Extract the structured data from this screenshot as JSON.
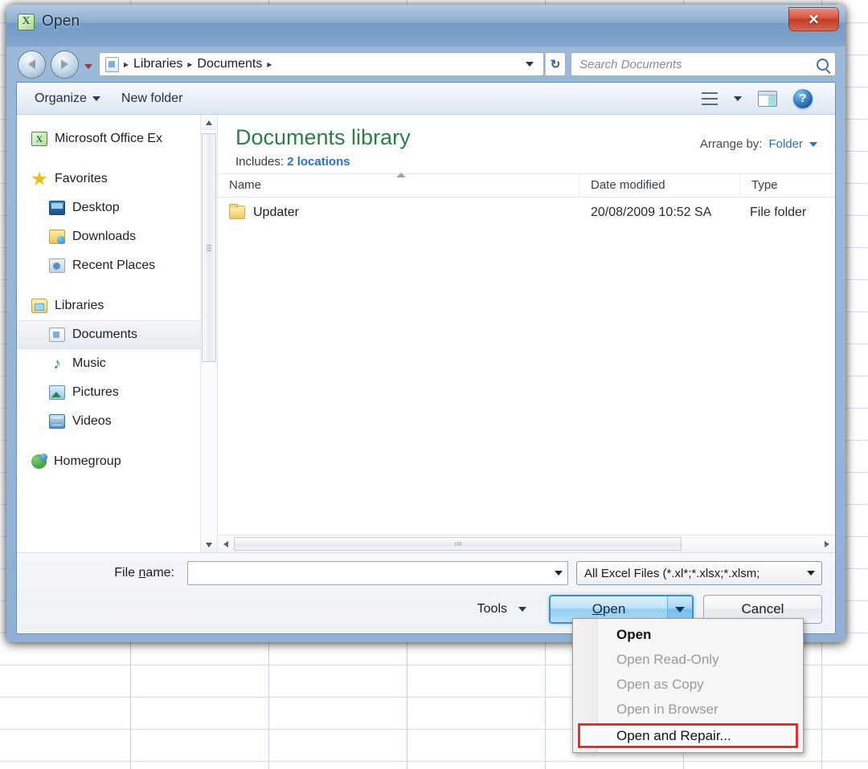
{
  "window": {
    "title": "Open",
    "app_icon": "excel-icon",
    "close_label": "✕"
  },
  "address_bar": {
    "back_icon": "back-arrow-icon",
    "forward_icon": "forward-arrow-icon",
    "recent_icon": "chevron-down-icon",
    "location_icon": "library-icon",
    "crumbs": [
      "Libraries",
      "Documents"
    ],
    "separator": "▸",
    "dropdown_icon": "chevron-down-icon",
    "refresh_icon": "refresh-icon",
    "refresh_glyph": "↻"
  },
  "search": {
    "placeholder": "Search Documents",
    "icon": "search-icon"
  },
  "toolbar": {
    "organize_label": "Organize",
    "new_folder_label": "New folder",
    "view_icon": "list-view-icon",
    "view_caret_icon": "chevron-down-icon",
    "preview_pane_icon": "preview-pane-icon",
    "help_icon": "help-icon",
    "help_glyph": "?"
  },
  "sidebar": {
    "items": [
      {
        "label": "Microsoft Office Ex",
        "icon": "excel-icon",
        "indent": "root",
        "selected": false
      },
      {
        "label": "Favorites",
        "icon": "star-icon",
        "indent": "root",
        "selected": false
      },
      {
        "label": "Desktop",
        "icon": "desktop-icon",
        "indent": "child",
        "selected": false
      },
      {
        "label": "Downloads",
        "icon": "downloads-icon",
        "indent": "child",
        "selected": false
      },
      {
        "label": "Recent Places",
        "icon": "recent-places-icon",
        "indent": "child",
        "selected": false
      },
      {
        "label": "Libraries",
        "icon": "libraries-icon",
        "indent": "root",
        "selected": false
      },
      {
        "label": "Documents",
        "icon": "documents-icon",
        "indent": "child",
        "selected": true
      },
      {
        "label": "Music",
        "icon": "music-icon",
        "indent": "child",
        "selected": false
      },
      {
        "label": "Pictures",
        "icon": "pictures-icon",
        "indent": "child",
        "selected": false
      },
      {
        "label": "Videos",
        "icon": "videos-icon",
        "indent": "child",
        "selected": false
      },
      {
        "label": "Homegroup",
        "icon": "homegroup-icon",
        "indent": "root",
        "selected": false
      }
    ]
  },
  "library_header": {
    "title": "Documents library",
    "includes_label": "Includes:",
    "includes_link": "2 locations",
    "arrange_label": "Arrange by:",
    "arrange_value": "Folder",
    "arrange_caret_icon": "chevron-down-icon",
    "title_color": "#2e7d46",
    "link_color": "#2a72c4"
  },
  "file_list": {
    "columns": [
      "Name",
      "Date modified",
      "Type"
    ],
    "rows": [
      {
        "name": "Updater",
        "date_modified": "20/08/2009 10:52 SA",
        "type": "File folder",
        "icon": "folder-icon"
      }
    ]
  },
  "footer": {
    "filename_label_pre": "File ",
    "filename_label_accel": "n",
    "filename_label_post": "ame:",
    "filename_value": "",
    "filename_caret_icon": "chevron-down-icon",
    "filetype_value": "All Excel Files (*.xl*;*.xlsx;*.xlsm;",
    "filetype_caret_icon": "chevron-down-icon",
    "tools_label": "Tools",
    "tools_caret_icon": "chevron-down-icon",
    "open_label_accel": "O",
    "open_label_rest": "pen",
    "open_caret_icon": "chevron-down-icon",
    "cancel_label": "Cancel"
  },
  "open_menu": {
    "items": [
      {
        "label": "Open",
        "state": "default"
      },
      {
        "label": "Open Read-Only",
        "state": "disabled"
      },
      {
        "label": "Open as Copy",
        "state": "disabled"
      },
      {
        "label": "Open in Browser",
        "state": "disabled"
      },
      {
        "label": "Open and Repair...",
        "state": "highlighted"
      }
    ],
    "highlight_color": "#e03030"
  }
}
